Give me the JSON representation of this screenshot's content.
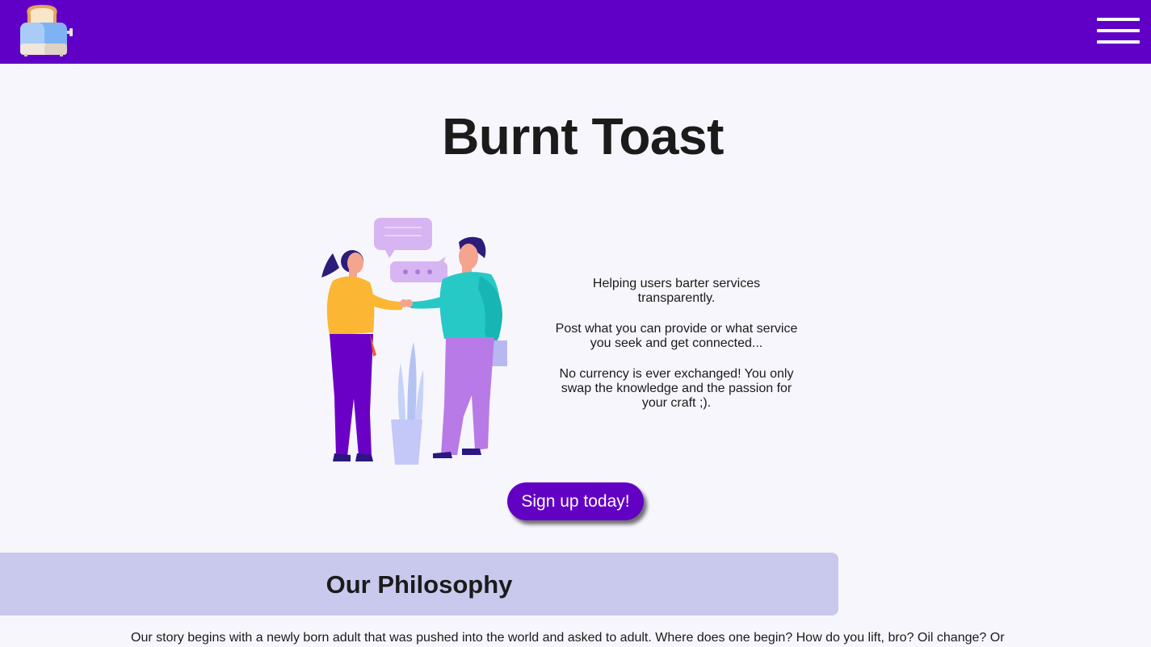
{
  "brand": {
    "logo_icon": "toaster-logo-icon",
    "accent_color": "#6000c6"
  },
  "nav": {
    "menu_icon": "hamburger-menu-icon"
  },
  "hero": {
    "title": "Burnt Toast",
    "illustration_icon": "handshake-illustration",
    "tagline_1": "Helping users barter services transparently.",
    "tagline_2": "Post what you can provide or what service you seek and get connected...",
    "tagline_3": "No currency is ever exchanged! You only swap the knowledge and the passion for your craft ;).",
    "signup_label": "Sign up today!"
  },
  "philosophy": {
    "title": "Our Philosophy",
    "text": "Our story begins with a newly born adult that was pushed into the world and asked to adult. Where does one begin? How do you lift, bro? Oil change? Or"
  }
}
